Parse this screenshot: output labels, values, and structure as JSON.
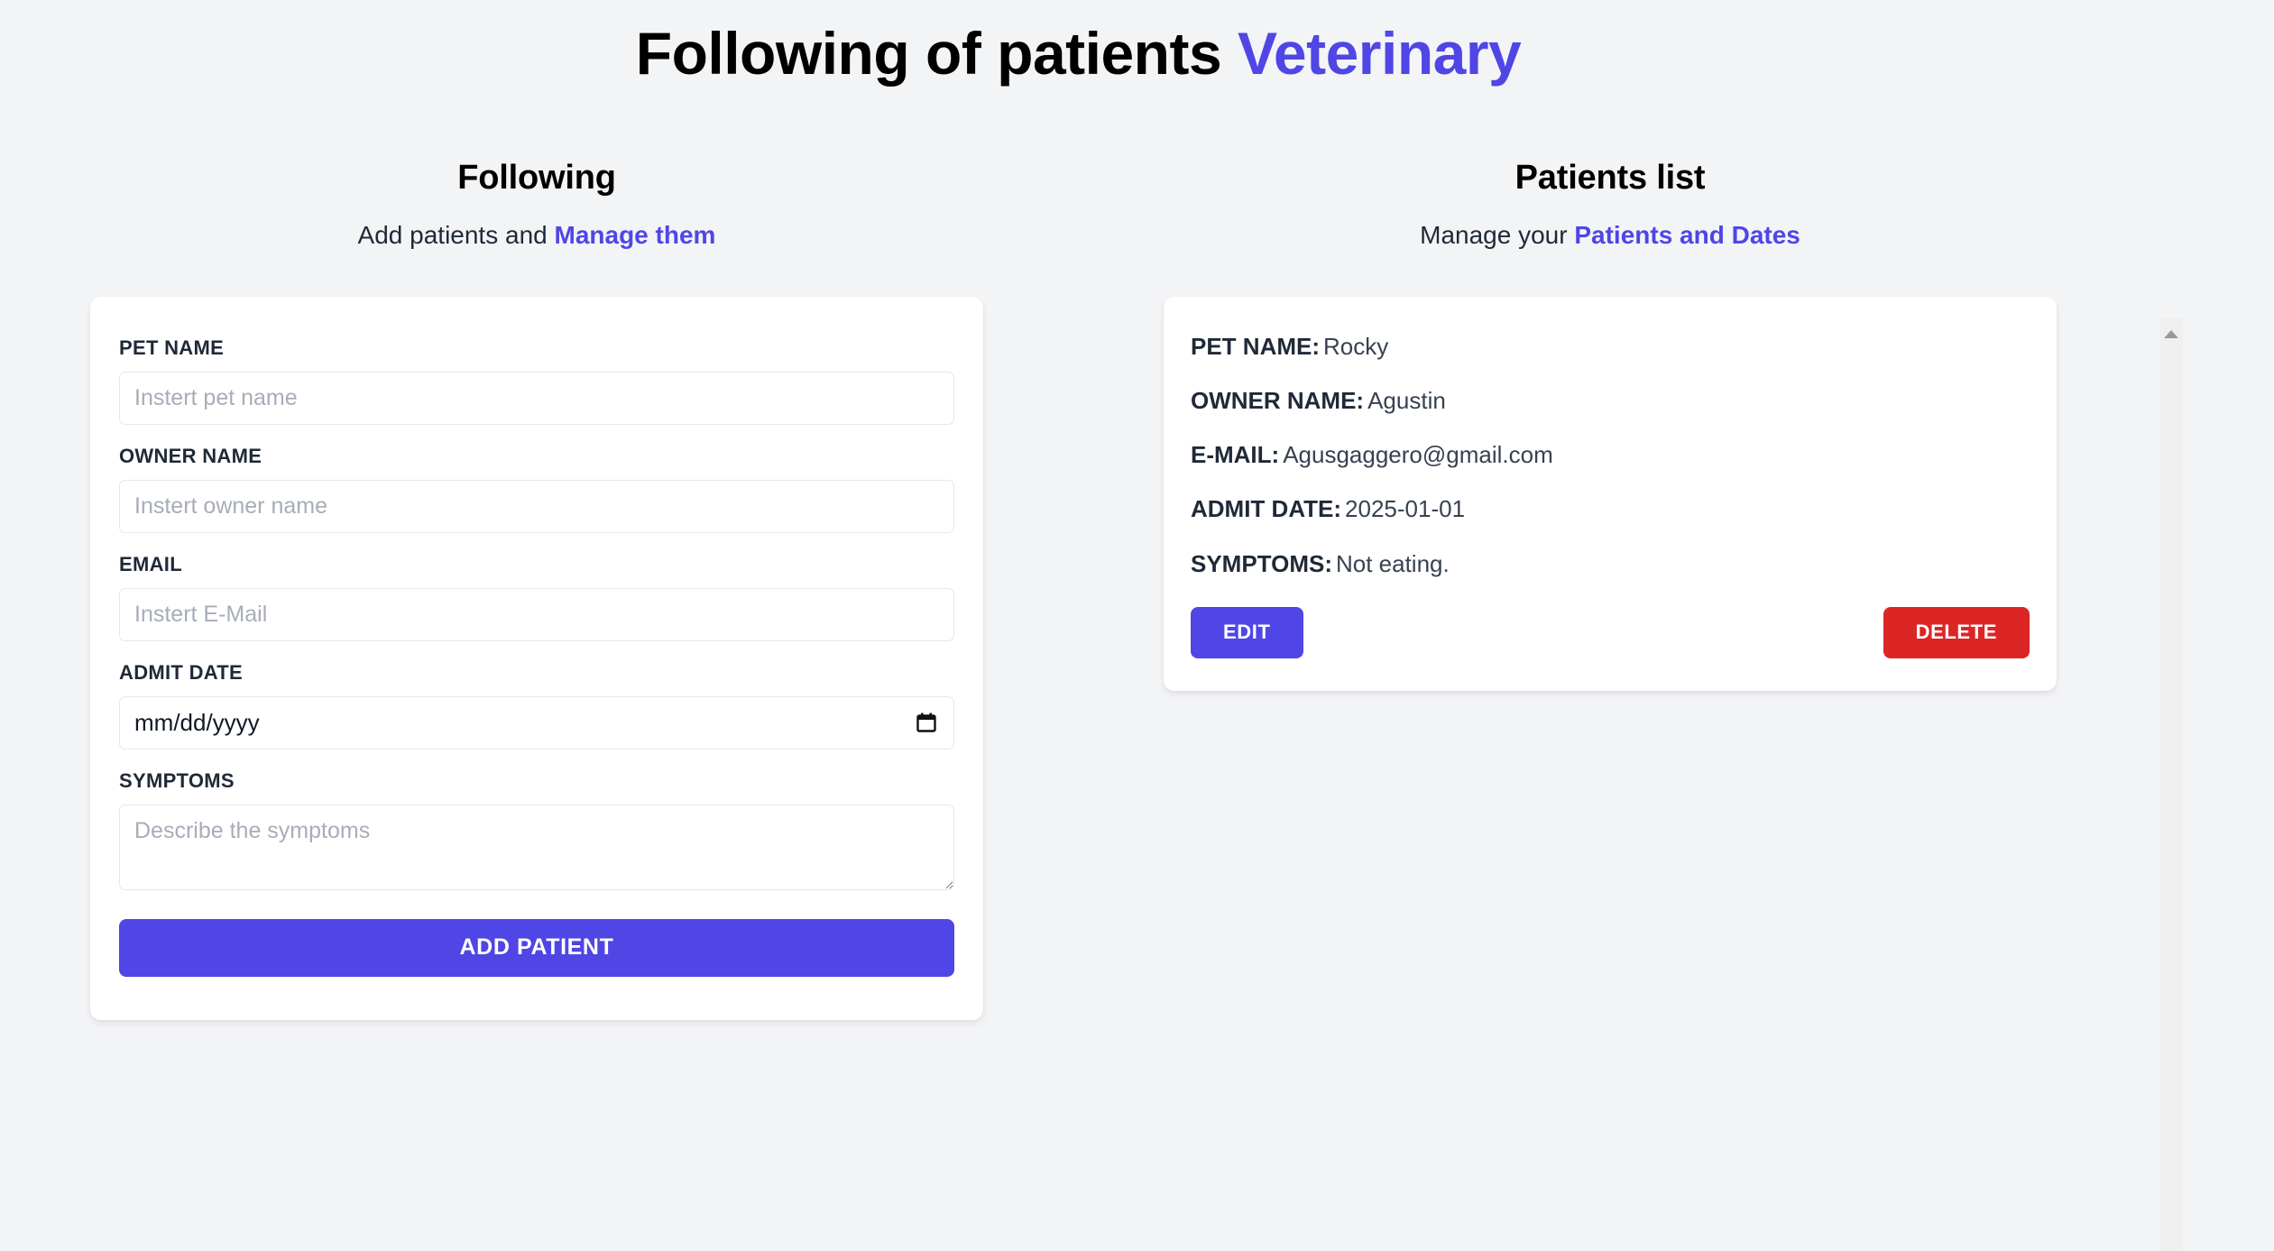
{
  "header": {
    "title_plain": "Following of patients",
    "title_accent": "Veterinary",
    "accent_color": "#4f46e5"
  },
  "left_column": {
    "heading": "Following",
    "subtitle_plain": "Add patients and",
    "subtitle_accent": "Manage them",
    "form": {
      "fields": [
        {
          "label": "PET NAME",
          "placeholder": "Instert pet name",
          "value": ""
        },
        {
          "label": "OWNER NAME",
          "placeholder": "Instert owner name",
          "value": ""
        },
        {
          "label": "EMAIL",
          "placeholder": "Instert E-Mail",
          "value": ""
        }
      ],
      "date_field": {
        "label": "ADMIT DATE",
        "display_value": "mm/dd/yyyy",
        "icon": "calendar-icon"
      },
      "symptoms_field": {
        "label": "SYMPTOMS",
        "placeholder": "Describe the symptoms",
        "value": ""
      },
      "submit_label": "ADD PATIENT"
    }
  },
  "right_column": {
    "heading": "Patients list",
    "subtitle_plain": "Manage your",
    "subtitle_accent": "Patients and Dates",
    "patients": [
      {
        "pet_name_label": "PET NAME:",
        "pet_name": "Rocky",
        "owner_name_label": "OWNER NAME:",
        "owner_name": "Agustin",
        "email_label": "E-MAIL:",
        "email": "Agusgaggero@gmail.com",
        "admit_date_label": "ADMIT DATE:",
        "admit_date": "2025-01-01",
        "symptoms_label": "SYMPTOMS:",
        "symptoms": "Not eating.",
        "edit_label": "EDIT",
        "delete_label": "DELETE",
        "edit_color": "#4f46e5",
        "delete_color": "#dc2626"
      }
    ]
  },
  "scrollbar": {
    "up_arrow_icon": "scroll-up-arrow-icon"
  }
}
